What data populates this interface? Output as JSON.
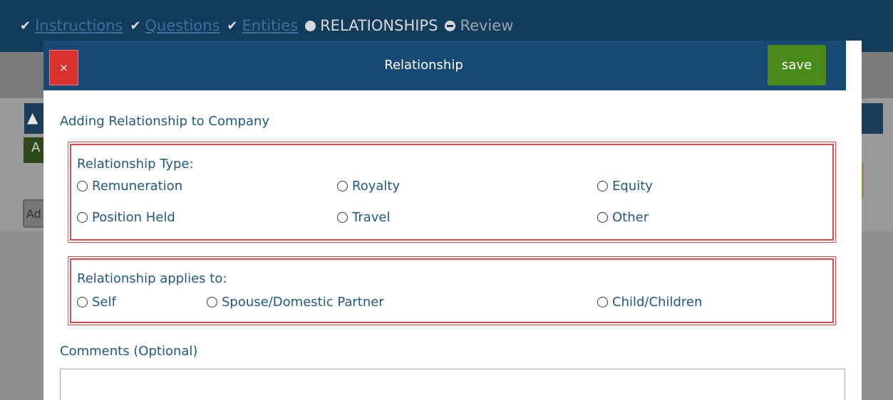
{
  "steps": [
    {
      "label": "Instructions",
      "status": "done"
    },
    {
      "label": "Questions",
      "status": "done"
    },
    {
      "label": "Entities",
      "status": "done"
    },
    {
      "label": "RELATIONSHIPS",
      "status": "current"
    },
    {
      "label": "Review",
      "status": "todo"
    }
  ],
  "background": {
    "green_tab_text": "A",
    "add_button_text": "Ad"
  },
  "modal": {
    "close_label": "×",
    "title": "Relationship",
    "save_label": "save",
    "subtitle": "Adding Relationship to Company",
    "relationship_type": {
      "label": "Relationship Type:",
      "options": [
        "Remuneration",
        "Royalty",
        "Equity",
        "Position Held",
        "Travel",
        "Other"
      ]
    },
    "applies_to": {
      "label": "Relationship applies to:",
      "options": [
        "Self",
        "Spouse/Domestic Partner",
        "Child/Children"
      ]
    },
    "comments_label": "Comments (Optional)",
    "comments_value": ""
  },
  "colors": {
    "header": "#164a74",
    "close": "#d9312f",
    "save": "#4a8a1a",
    "text": "#1e5a7e",
    "highlight_border": "#d44a4a"
  }
}
